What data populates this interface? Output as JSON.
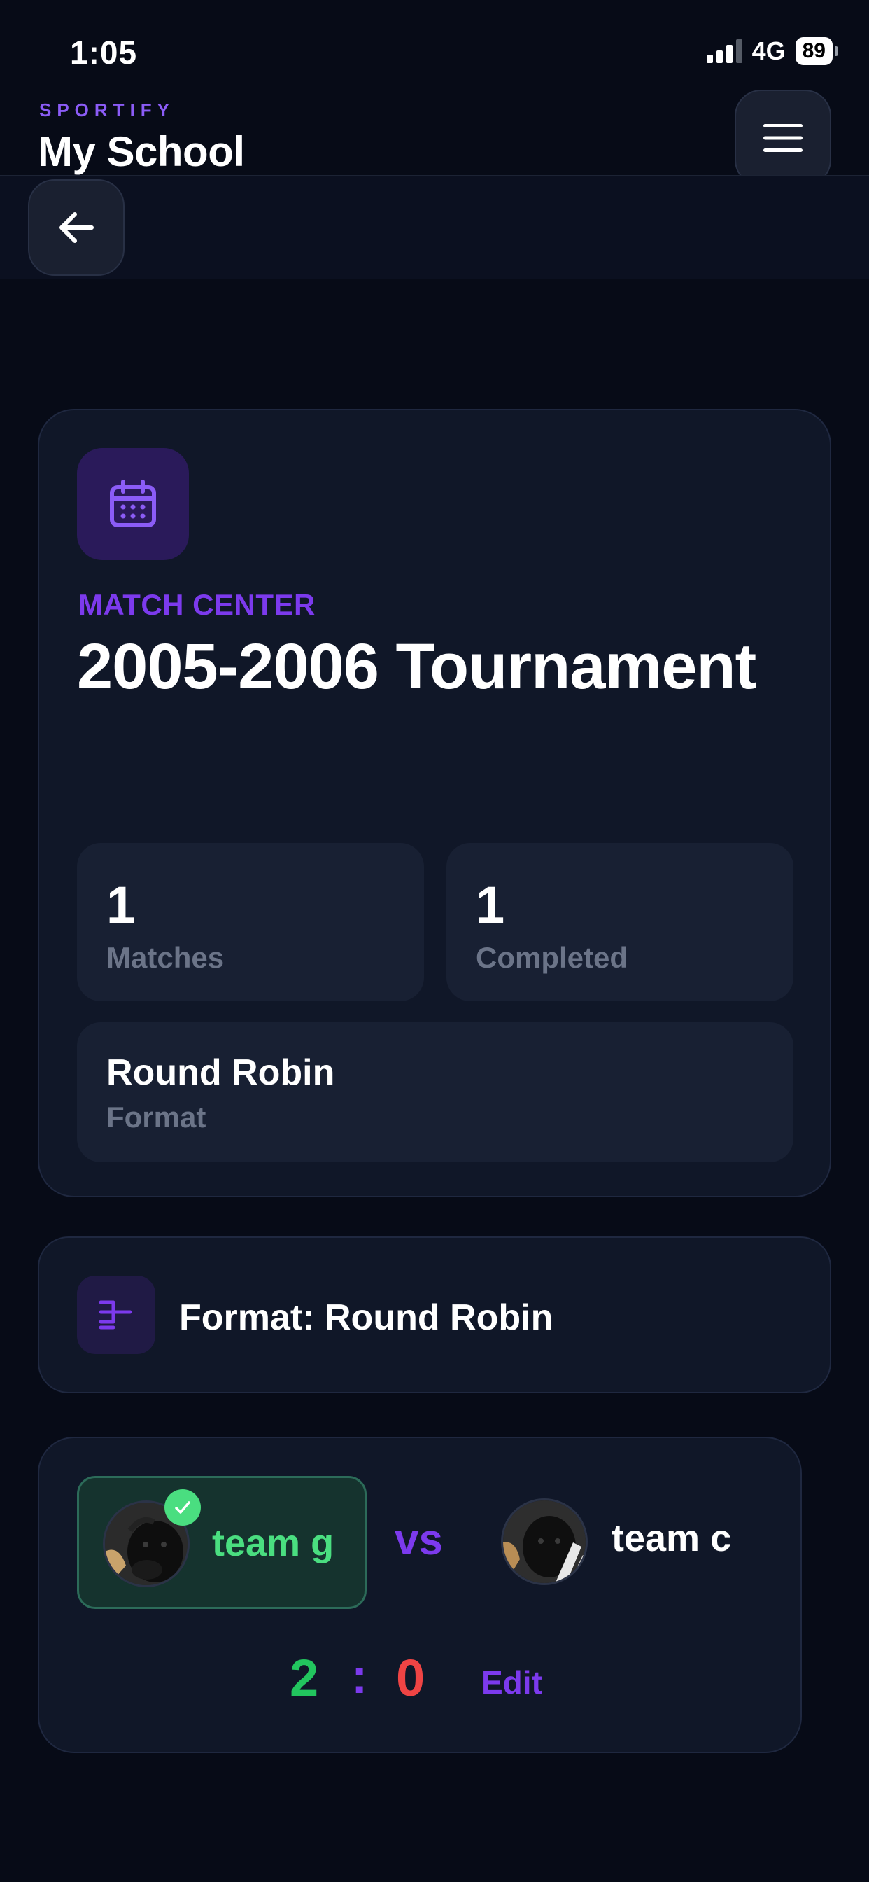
{
  "status_bar": {
    "time": "1:05",
    "network": "4G",
    "battery": "89"
  },
  "header": {
    "brand": "SPORTIFY",
    "school": "My School",
    "menu_icon": "hamburger-menu-icon",
    "back_icon": "arrow-left-icon"
  },
  "hero": {
    "icon": "calendar-icon",
    "eyebrow": "MATCH CENTER",
    "title": "2005-2006 Tournament",
    "stats": {
      "matches_value": "1",
      "matches_label": "Matches",
      "completed_value": "1",
      "completed_label": "Completed",
      "format_value": "Round Robin",
      "format_label": "Format"
    }
  },
  "format_card": {
    "icon": "bracket-icon",
    "text": "Format: Round Robin"
  },
  "match": {
    "home_team": "team g",
    "away_team": "team c",
    "vs": "vs",
    "home_score": "2",
    "separator": ":",
    "away_score": "0",
    "edit_label": "Edit",
    "winner_icon": "check-icon"
  },
  "colors": {
    "background": "#070b17",
    "card": "#101728",
    "accent": "#7c3aed",
    "win": "#22c55e",
    "loss": "#ef4444"
  }
}
